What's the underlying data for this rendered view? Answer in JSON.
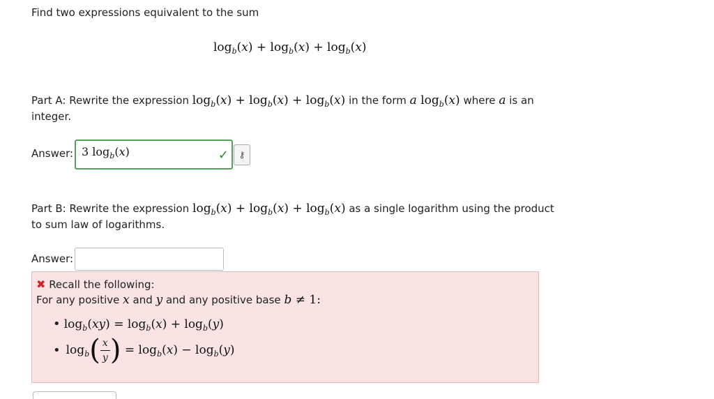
{
  "question": {
    "prompt": "Find two expressions equivalent to the sum",
    "sum_expression": "log_b(x) + log_b(x) + log_b(x)"
  },
  "part_a": {
    "text_before": "Part A: Rewrite the expression",
    "text_middle": "in the form",
    "text_after": "where",
    "text_end": "is an",
    "line2": "integer.",
    "answer_label": "Answer:",
    "answer_value": "3 log_b(x)",
    "status": "correct",
    "status_color": "#2e8a38"
  },
  "part_b": {
    "text_before": "Part B: Rewrite the expression",
    "text_after": "as a single logarithm using the product",
    "line2": "to sum law of logarithms.",
    "answer_label": "Answer:",
    "answer_value": ""
  },
  "feedback": {
    "title": "Recall the following:",
    "line1_a": "For any positive",
    "line1_b": "and",
    "line1_c": "and any positive base",
    "rule1": "log_b(xy) = log_b(x) + log_b(y)",
    "rule2": "log_b(x/y) = log_b(x) − log_b(y)",
    "bg_color": "#f9e3e3",
    "icon_color": "#d42020"
  },
  "icons": [
    "check-icon",
    "key-icon",
    "x-icon"
  ]
}
